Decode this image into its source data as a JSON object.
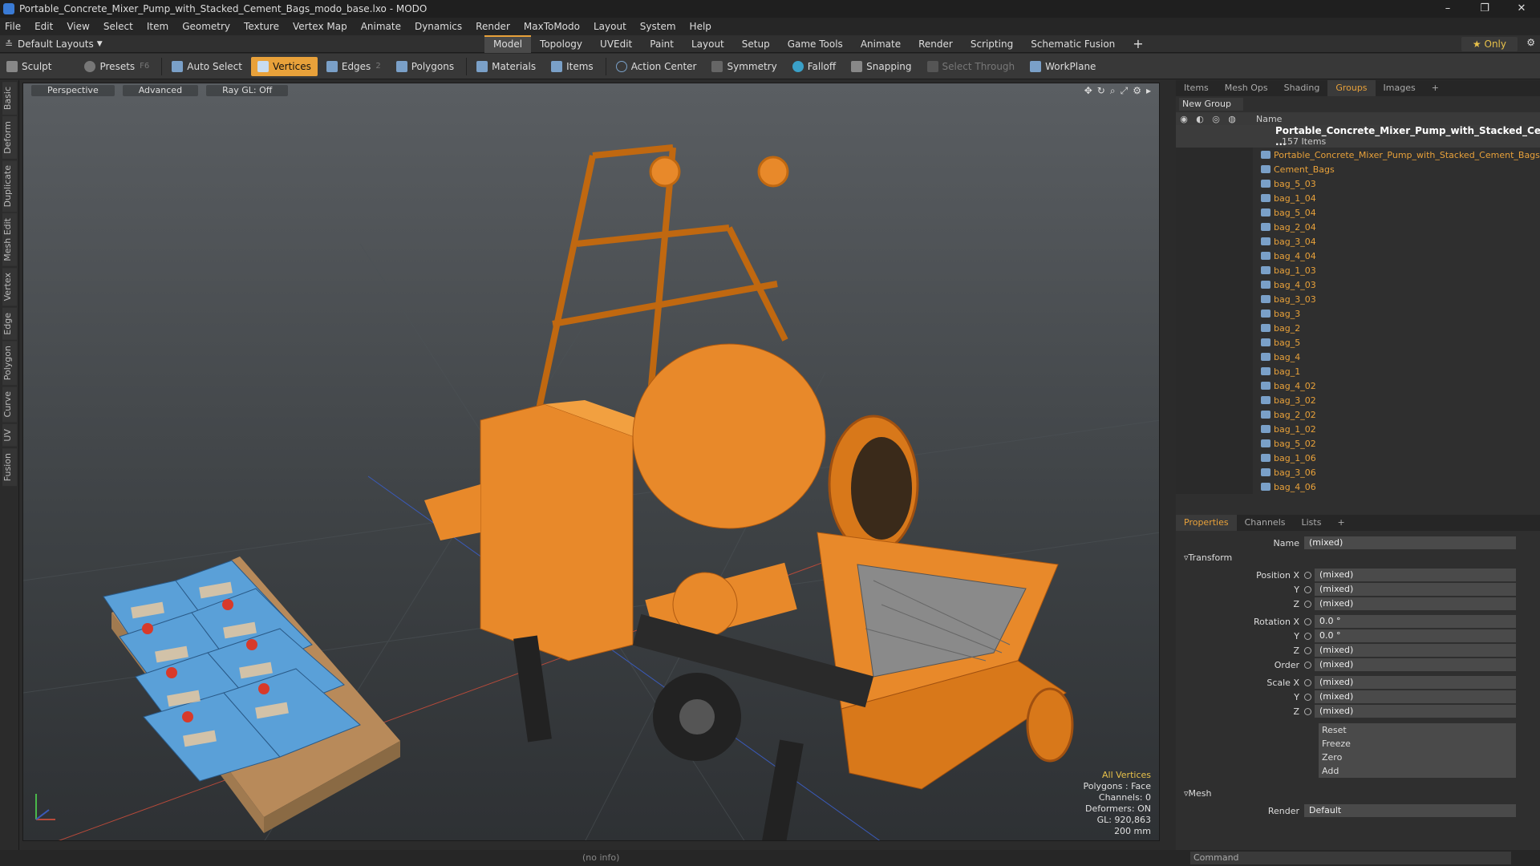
{
  "window": {
    "title": "Portable_Concrete_Mixer_Pump_with_Stacked_Cement_Bags_modo_base.lxo - MODO"
  },
  "menu": [
    "File",
    "Edit",
    "View",
    "Select",
    "Item",
    "Geometry",
    "Texture",
    "Vertex Map",
    "Animate",
    "Dynamics",
    "Render",
    "MaxToModo",
    "Layout",
    "System",
    "Help"
  ],
  "layout": {
    "name": "Default Layouts",
    "only": "Only"
  },
  "tabs": [
    "Model",
    "Topology",
    "UVEdit",
    "Paint",
    "Layout",
    "Setup",
    "Game Tools",
    "Animate",
    "Render",
    "Scripting",
    "Schematic Fusion"
  ],
  "tools": {
    "sculpt": "Sculpt",
    "presets": "Presets",
    "presets_key": "F6",
    "auto_select": "Auto Select",
    "vertices": "Vertices",
    "edges": "Edges",
    "edges_num": "2",
    "polygons": "Polygons",
    "materials": "Materials",
    "items": "Items",
    "action_center": "Action Center",
    "symmetry": "Symmetry",
    "falloff": "Falloff",
    "snapping": "Snapping",
    "select_through": "Select Through",
    "workplane": "WorkPlane"
  },
  "left_tabs": [
    "Basic",
    "Deform",
    "Duplicate",
    "Mesh Edit",
    "Vertex",
    "Edge",
    "Polygon",
    "Curve",
    "UV",
    "Fusion"
  ],
  "viewport": {
    "perspective": "Perspective",
    "advanced": "Advanced",
    "raygl": "Ray GL: Off"
  },
  "info": {
    "all_vertices": "All Vertices",
    "polygons": "Polygons : Face",
    "channels": "Channels: 0",
    "deformers": "Deformers: ON",
    "gl": "GL: 920,863",
    "scale": "200 mm"
  },
  "panel_tabs": [
    "Items",
    "Mesh Ops",
    "Shading",
    "Groups",
    "Images"
  ],
  "new_group": "New Group",
  "list_header": {
    "name": "Name"
  },
  "group": {
    "name": "Portable_Concrete_Mixer_Pump_with_Stacked_Ce ...",
    "count": "157 Items"
  },
  "items": [
    "Portable_Concrete_Mixer_Pump_with_Stacked_Cement_Bags",
    "Cement_Bags",
    "bag_5_03",
    "bag_1_04",
    "bag_5_04",
    "bag_2_04",
    "bag_3_04",
    "bag_4_04",
    "bag_1_03",
    "bag_4_03",
    "bag_3_03",
    "bag_3",
    "bag_2",
    "bag_5",
    "bag_4",
    "bag_1",
    "bag_4_02",
    "bag_3_02",
    "bag_2_02",
    "bag_1_02",
    "bag_5_02",
    "bag_1_06",
    "bag_3_06",
    "bag_4_06"
  ],
  "prop_tabs": [
    "Properties",
    "Channels",
    "Lists"
  ],
  "props": {
    "name_label": "Name",
    "name_val": "(mixed)",
    "transform": "Transform",
    "pos_x": "Position X",
    "pos_y": "Y",
    "pos_z": "Z",
    "pos_xv": "(mixed)",
    "pos_yv": "(mixed)",
    "pos_zv": "(mixed)",
    "rot_x": "Rotation X",
    "rot_y": "Y",
    "rot_z": "Z",
    "rot_xv": "0.0 °",
    "rot_yv": "0.0 °",
    "rot_zv": "(mixed)",
    "order": "Order",
    "order_v": "(mixed)",
    "scl_x": "Scale X",
    "scl_y": "Y",
    "scl_z": "Z",
    "scl_xv": "(mixed)",
    "scl_yv": "(mixed)",
    "scl_zv": "(mixed)",
    "reset": "Reset",
    "freeze": "Freeze",
    "zero": "Zero",
    "add": "Add",
    "mesh": "Mesh",
    "render": "Render",
    "render_v": "Default"
  },
  "status": {
    "noinfo": "(no info)",
    "command": "Command"
  },
  "colors": {
    "accent": "#e8a13a",
    "machine": "#e8892a",
    "bags": "#5aa0d8"
  }
}
